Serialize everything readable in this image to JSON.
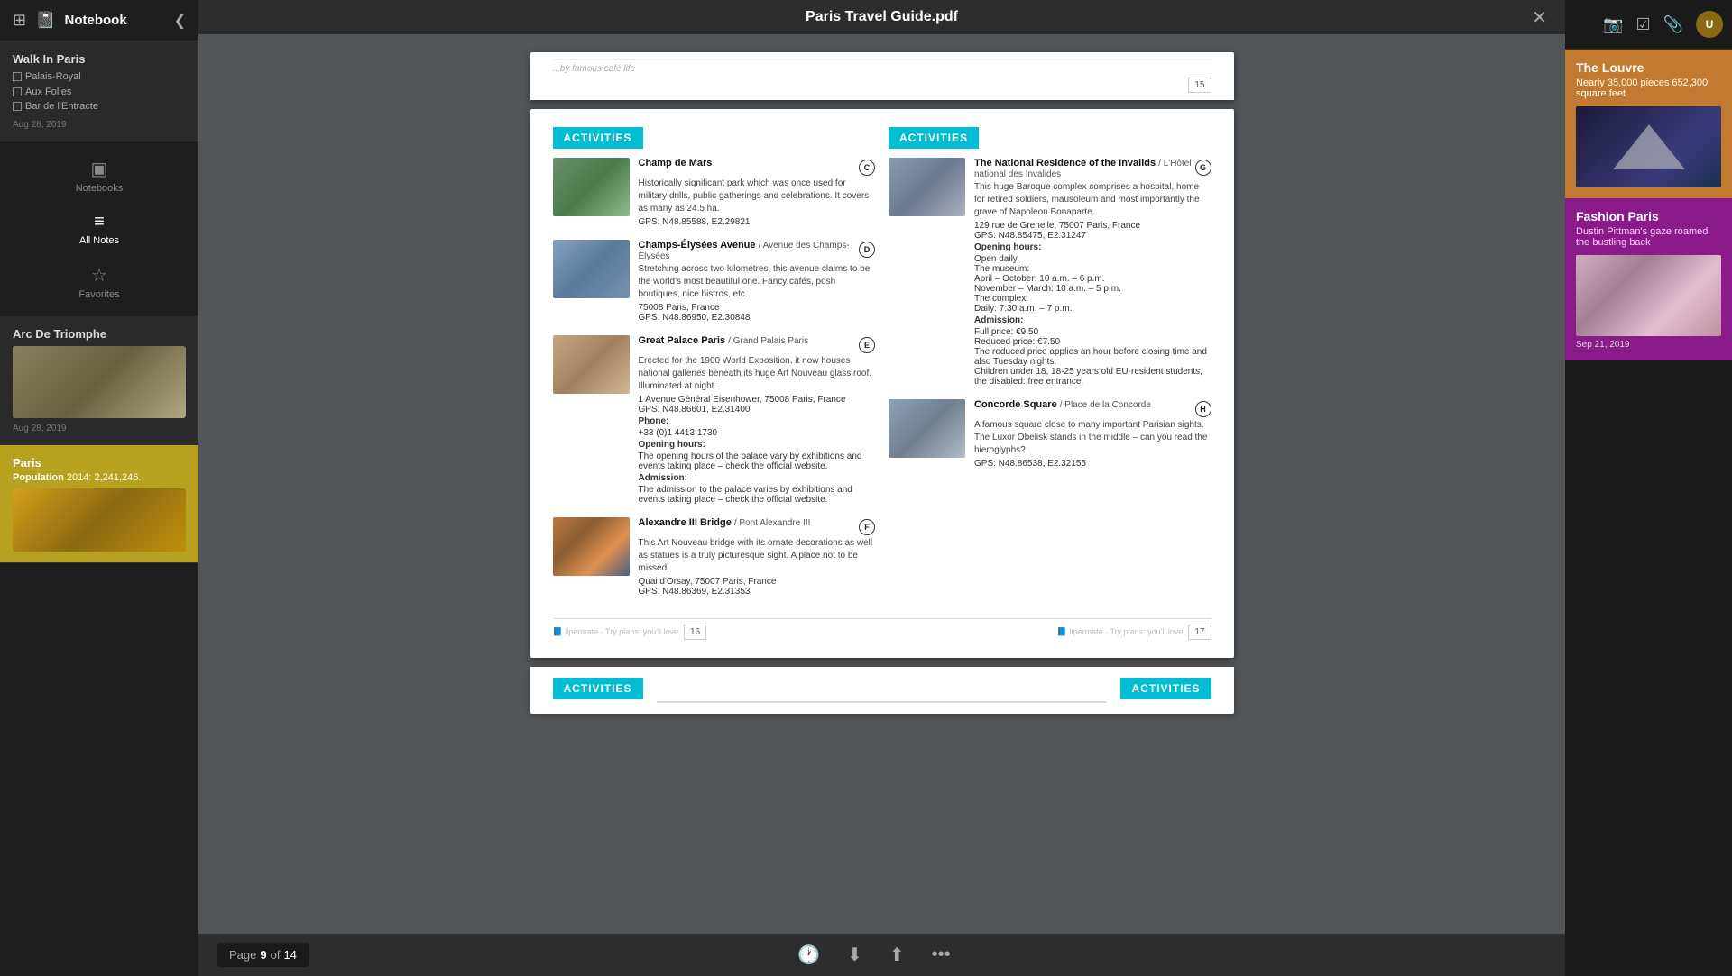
{
  "app": {
    "title": "Notebook",
    "back_label": "◀"
  },
  "sidebar": {
    "top": {
      "grid_icon": "⊞",
      "notebook_icon": "📓",
      "title": "Notebook",
      "back": "❮"
    },
    "notes": [
      {
        "id": "walk-in-paris",
        "title": "Walk In Paris",
        "checklist": [
          "Palais-Royal",
          "Aux Folies",
          "Bar de l'Entracte"
        ],
        "date": "Aug 28, 2019"
      },
      {
        "id": "arc-de-triomphe",
        "title": "Arc De Triomphe",
        "date": "Aug 28, 2019",
        "has_image": true
      },
      {
        "id": "paris-population",
        "title": "Paris",
        "subtitle": "Population 2014:",
        "text": "2,241,246.",
        "has_image": true
      }
    ],
    "nav": [
      {
        "id": "notebooks",
        "icon": "▣",
        "label": "Notebooks"
      },
      {
        "id": "all-notes",
        "icon": "≡",
        "label": "All Notes",
        "active": true
      },
      {
        "id": "favorites",
        "icon": "☆",
        "label": "Favorites"
      }
    ]
  },
  "pdf": {
    "title": "Paris Travel Guide.pdf",
    "close_icon": "✕",
    "page_indicator": {
      "label": "Page",
      "current": "9",
      "of": "of",
      "total": "14"
    },
    "toolbar_icons": [
      "🕐",
      "⬇",
      "⬆",
      "•••"
    ],
    "page_top_text": "...by famous café life",
    "pages": [
      {
        "left_col": {
          "header": "ACTIVITIES",
          "items": [
            {
              "id": "champ-de-mars",
              "badge": "C",
              "title": "Champ de Mars",
              "subtitle": "",
              "desc": "Historically significant park which was once used for military drills, public gatherings and celebrations. It covers as many as 24.5 ha.",
              "detail": "GPS: N48.85588, E2.29821",
              "img_class": "champs-de-mars"
            },
            {
              "id": "champs-elysees",
              "badge": "D",
              "title": "Champs-Élysées Avenue",
              "subtitle": "/ Avenue des Champs-Élysées",
              "desc": "Stretching across two kilometres, this avenue claims to be the world's most beautiful one. Fancy cafés, posh boutiques, nice bistros, etc.",
              "detail": "75008 Paris, France\nGPS: N48.86950, E2.30848",
              "img_class": "champs-elysees"
            },
            {
              "id": "grand-palais",
              "badge": "E",
              "title": "Great Palace Paris",
              "subtitle": "/ Grand Palais Paris",
              "desc": "Erected for the 1900 World Exposition, it now houses national galleries beneath its huge Art Nouveau glass roof. Illuminated at night.",
              "detail": "1 Avenue Général Eisenhower, 75008 Paris, France\nGPS: N48.86601, E2.31400\nPhone:\n+33 (0)1 4413 1730",
              "opening_hours": "Opening hours:\nThe opening hours of the palace vary by exhibitions and events taking place – check the official website.",
              "admission": "Admission:\nThe admission to the palace varies by exhibitions and events taking place – check the official website.",
              "img_class": "grand-palais"
            },
            {
              "id": "alexandre",
              "badge": "F",
              "title": "Alexandre III Bridge",
              "subtitle": "/ Pont Alexandre III",
              "desc": "This Art Nouveau bridge with its ornate decorations as well as statues is a truly picturesque sight. A place not to be missed!",
              "detail": "Quai d'Orsay, 75007 Paris, France\nGPS: N48.86369, E2.31353",
              "img_class": "alexandre"
            }
          ]
        },
        "right_col": {
          "header": "ACTIVITIES",
          "items": [
            {
              "id": "invalides",
              "badge": "G",
              "title": "The National Residence of the Invalids",
              "subtitle": "/ L'Hôtel national des Invalides",
              "desc": "This huge Baroque complex comprises a hospital, home for retired soldiers, mausoleum and most importantly the grave of Napoleon Bonaparte.",
              "detail": "129 rue de Grenelle, 75007 Paris, France\nGPS: N48.85475, E2.31247",
              "opening_hours_label": "Opening hours:",
              "opening_hours": "Open daily.\nThe museum:\nApril – October: 10 a.m. – 6 p.m.\nNovember – March: 10 a.m. – 5 p.m.\nThe complex:\nDaily: 7:30 a.m. – 7 p.m.",
              "admission_label": "Admission:",
              "admission": "Full price: €9.50\nReduced price: €7.50\nThe reduced price applies an hour before closing time and also Tuesday nights.\nChildren under 18, 18-25 years old EU-resident students, the disabled: free entrance.",
              "img_class": "invalides"
            },
            {
              "id": "concorde",
              "badge": "H",
              "title": "Concorde Square",
              "subtitle": "/ Place de la Concorde",
              "desc": "A famous square close to many important Parisian sights. The Luxor Obelisk stands in the middle – can you read the hieroglyphs?",
              "detail": "GPS: N48.86538, E2.32155",
              "img_class": "concorde"
            }
          ]
        },
        "footer": {
          "left_page": "16",
          "right_page": "17"
        }
      }
    ],
    "next_section_header": "ACTIVITIES"
  },
  "right_sidebar": {
    "icons": [
      "📷",
      "☑",
      "📎"
    ],
    "avatar_initials": "U",
    "louvre": {
      "title": "The Louvre",
      "text": "Nearly 35,000 pieces 652,300 square feet"
    },
    "fashion": {
      "title": "Fashion Paris",
      "text": "Dustin Pittman's gaze roamed the bustling back",
      "date": "Sep 21, 2019"
    }
  }
}
